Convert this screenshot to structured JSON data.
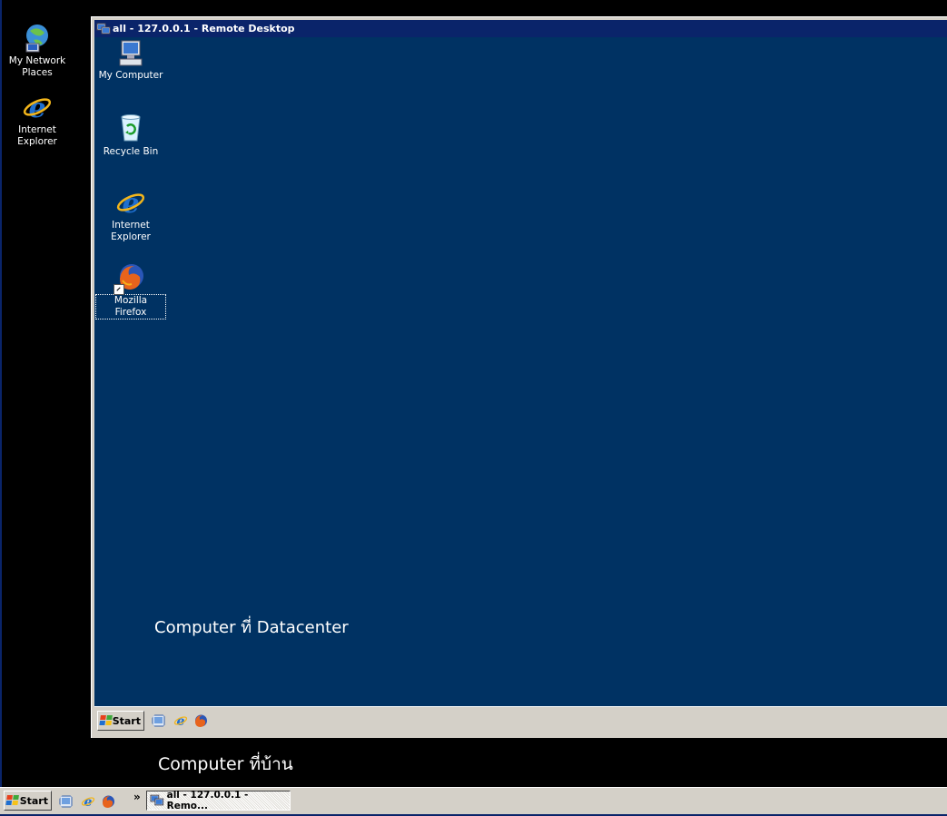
{
  "host_desktop": {
    "icons": [
      {
        "label_line1": "My Network",
        "label_line2": "Places",
        "icon": "network-places-icon"
      },
      {
        "label_line1": "Internet",
        "label_line2": "Explorer",
        "icon": "internet-explorer-icon"
      }
    ],
    "caption": "Computer ที่บ้าน"
  },
  "remote_window": {
    "title": "all - 127.0.0.1 - Remote Desktop",
    "icons": [
      {
        "label_line1": "My Computer",
        "label_line2": "",
        "icon": "my-computer-icon"
      },
      {
        "label_line1": "Recycle Bin",
        "label_line2": "",
        "icon": "recycle-bin-icon"
      },
      {
        "label_line1": "Internet",
        "label_line2": "Explorer",
        "icon": "internet-explorer-icon"
      },
      {
        "label_line1": "Mozilla Firefox",
        "label_line2": "",
        "icon": "firefox-icon"
      }
    ],
    "caption": "Computer ที่ Datacenter",
    "taskbar": {
      "start_label": "Start"
    }
  },
  "host_taskbar": {
    "start_label": "Start",
    "chevron": "»",
    "task_button_label": "all - 127.0.0.1 - Remo..."
  },
  "colors": {
    "remote_desktop_bg": "#003263",
    "titlebar": "#0a246a",
    "taskbar": "#d4d0c8"
  }
}
